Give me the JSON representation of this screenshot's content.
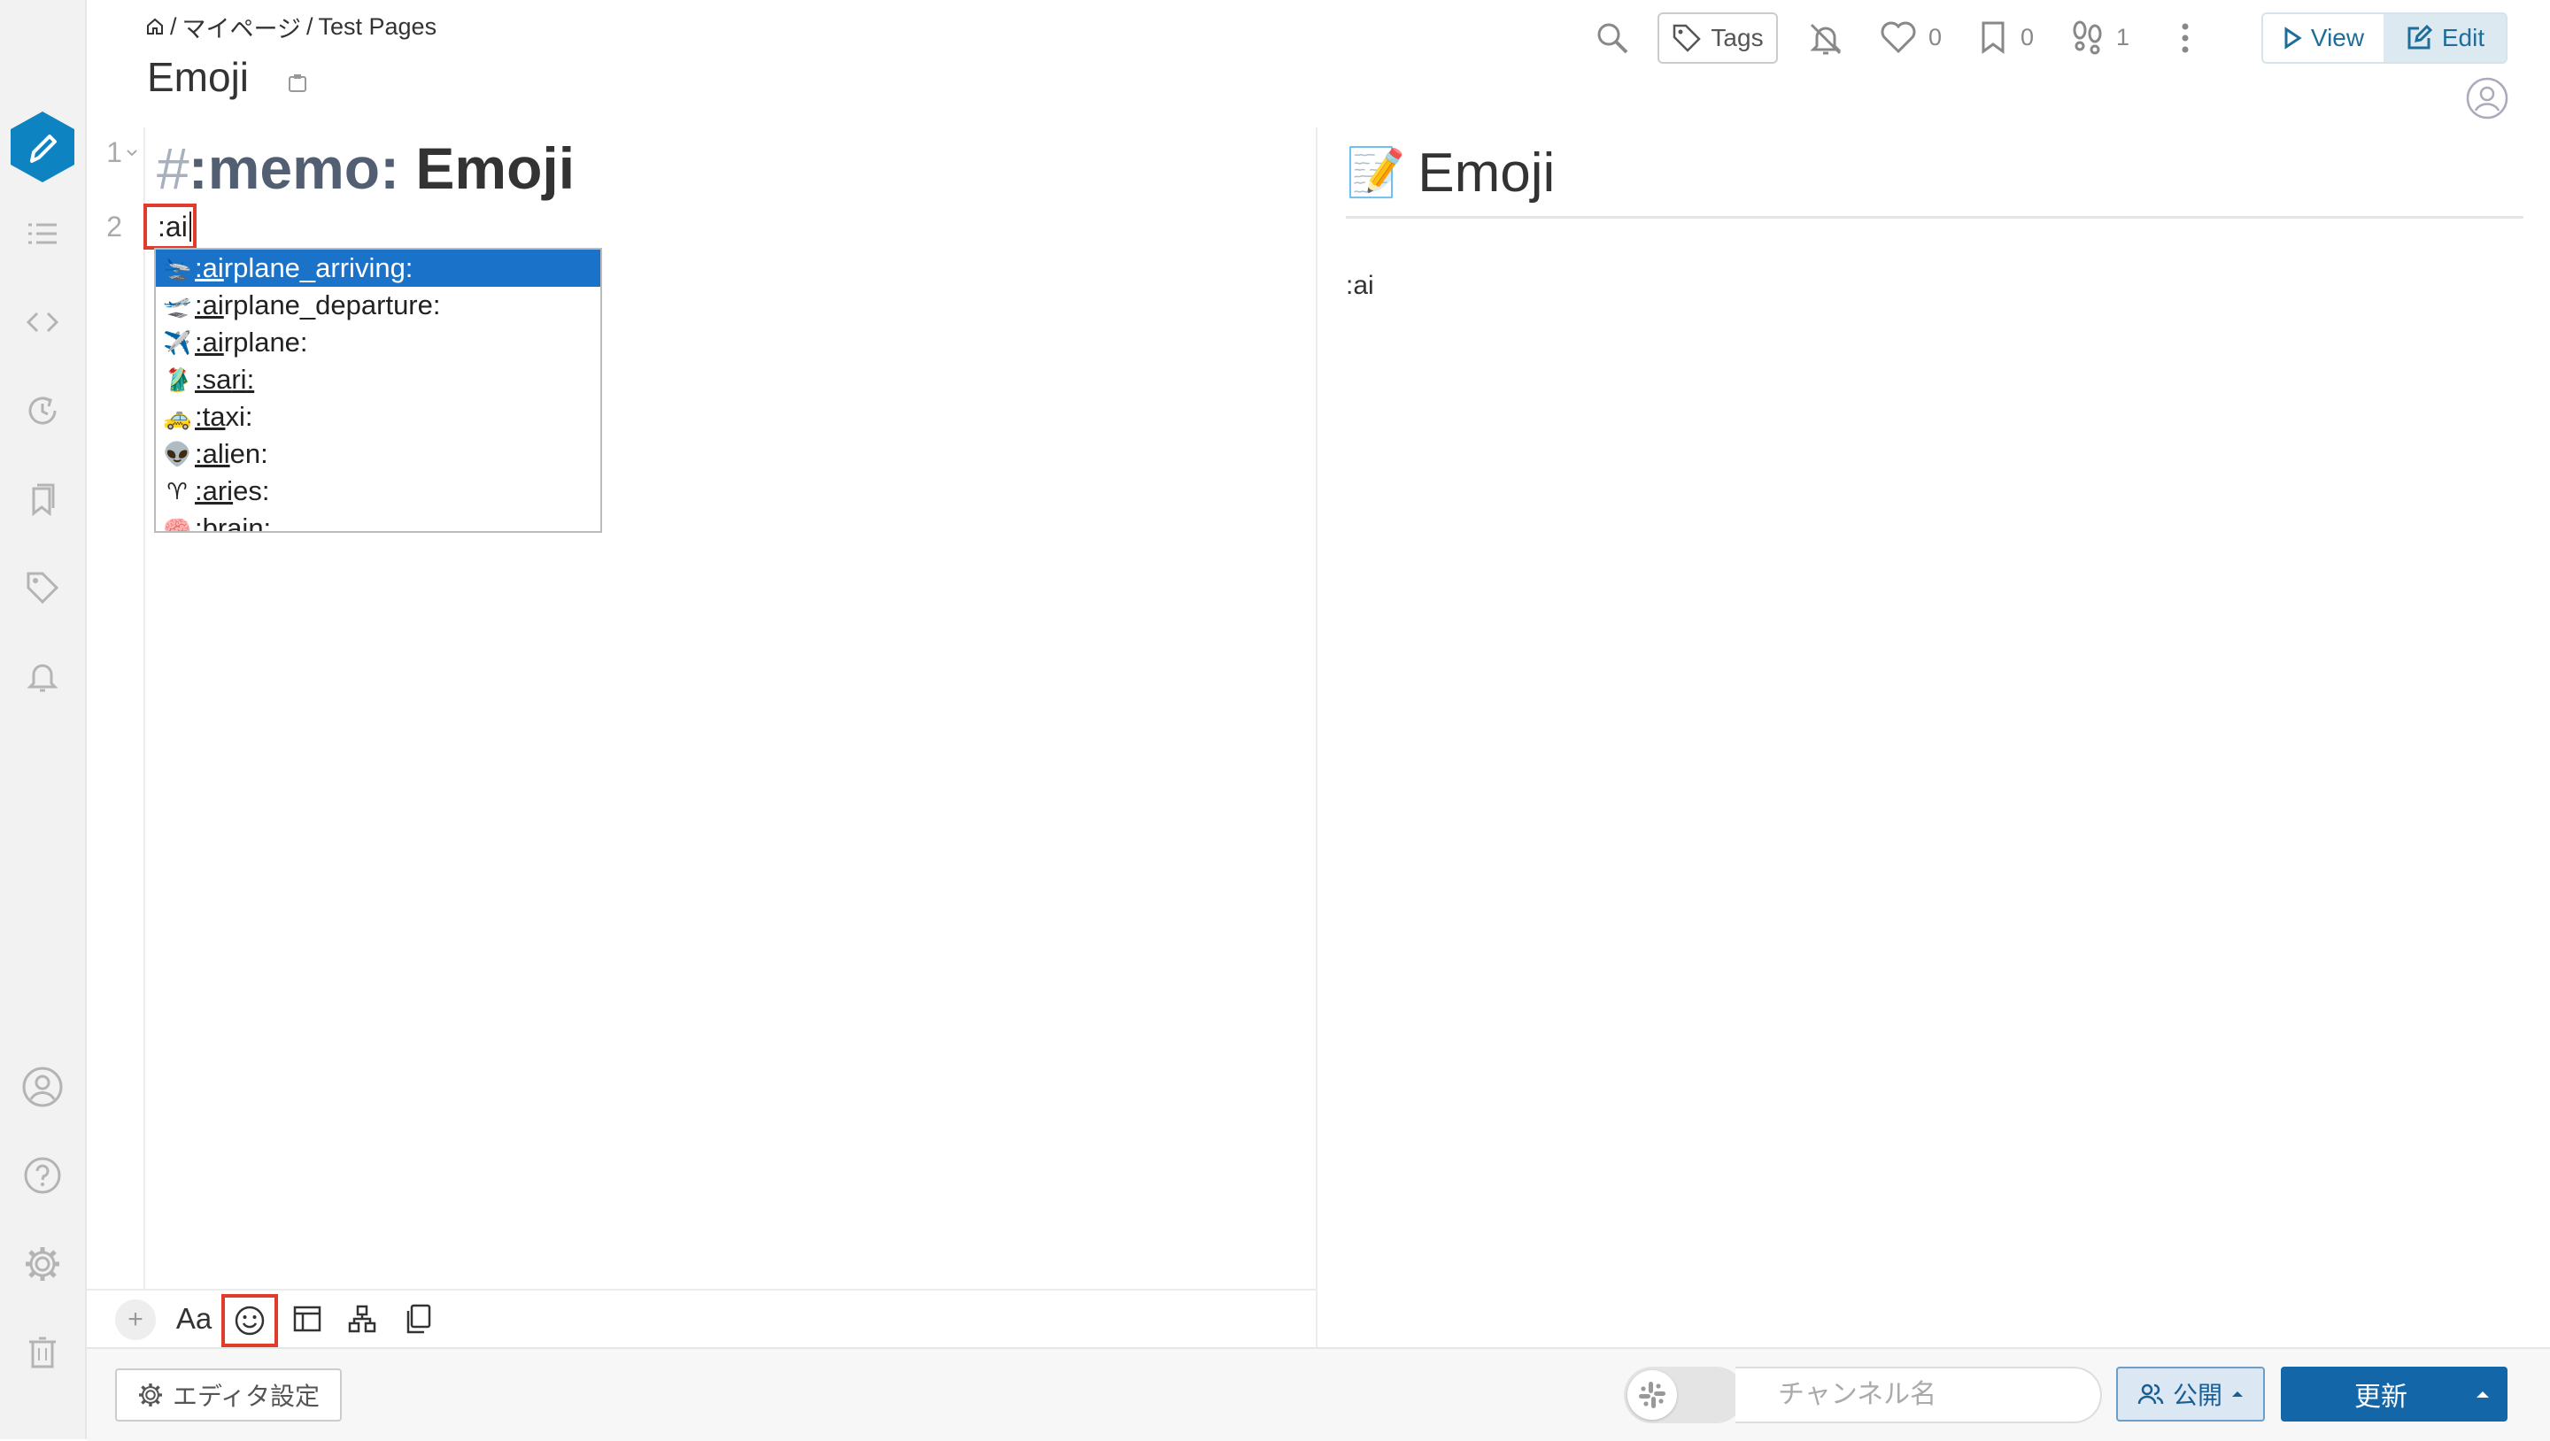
{
  "header": {
    "breadcrumb": [
      "/",
      "マイページ",
      "/",
      "Test Pages"
    ],
    "title": "Emoji",
    "tags_label": "Tags",
    "like_count": "0",
    "bookmark_count": "0",
    "seen_count": "1",
    "view_label": "View",
    "edit_label": "Edit"
  },
  "editor": {
    "line_numbers": [
      "1",
      "2"
    ],
    "line1": {
      "hash": "#",
      "emoji_code": ":memo:",
      "text": " Emoji"
    },
    "line2": ":ai",
    "autocomplete": [
      {
        "emoji": "🛬",
        "match": ":ai",
        "rest": "rplane_arriving:",
        "selected": true
      },
      {
        "emoji": "🛫",
        "match": ":ai",
        "rest": "rplane_departure:",
        "selected": false
      },
      {
        "emoji": "✈️",
        "match": ":ai",
        "rest": "rplane:",
        "selected": false
      },
      {
        "emoji": "🥻",
        "match": ":sa",
        "rest": "ri:",
        "match2": "ri",
        "selected": false
      },
      {
        "emoji": "🚕",
        "match": ":ta",
        "rest": "xi:",
        "selected": false
      },
      {
        "emoji": "👽",
        "match": ":ali",
        "rest": "en:",
        "selected": false
      },
      {
        "emoji": "♈",
        "match": ":ari",
        "rest": "es:",
        "selected": false
      },
      {
        "emoji": "🧠",
        "match": ":brai",
        "rest": "n:",
        "selected": false
      }
    ]
  },
  "preview": {
    "heading_emoji": "📝",
    "heading": "Emoji",
    "body": ":ai"
  },
  "toolbar": {
    "plus": "+",
    "font": "Aa"
  },
  "bottom": {
    "editor_settings": "エディタ設定",
    "channel_placeholder": "チャンネル名",
    "scope_label": "公開",
    "update_label": "更新"
  },
  "colors": {
    "accent": "#1366a8",
    "highlight": "#e03c2b",
    "selected_item": "#1a73c8",
    "edit_hex": "#0d84c1"
  }
}
